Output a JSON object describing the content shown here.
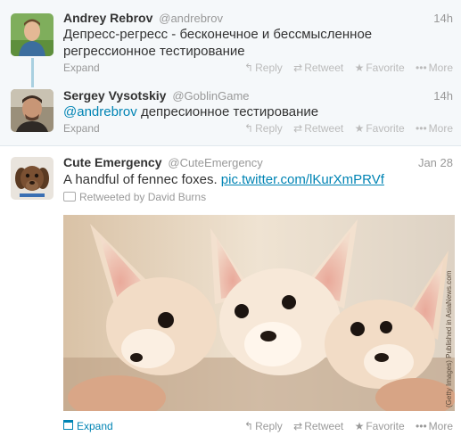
{
  "tweets": [
    {
      "fullname": "Andrey Rebrov",
      "username": "@andrebrov",
      "time": "14h",
      "text": "Депресс-регресс - бесконечное и бессмысленное регрессионное тестирование",
      "expand": "Expand",
      "actions": {
        "reply": "Reply",
        "retweet": "Retweet",
        "favorite": "Favorite",
        "more": "More"
      }
    },
    {
      "fullname": "Sergey Vysotskiy",
      "username": "@GoblinGame",
      "time": "14h",
      "mention": "@andrebrov",
      "text": " депресионное тестирование",
      "expand": "Expand",
      "actions": {
        "reply": "Reply",
        "retweet": "Retweet",
        "favorite": "Favorite",
        "more": "More"
      }
    },
    {
      "fullname": "Cute Emergency",
      "username": "@CuteEmergency",
      "time": "Jan 28",
      "text": "A handful of fennec foxes. ",
      "link": "pic.twitter.com/lKurXmPRVf",
      "retweeted_by": "Retweeted by David Burns",
      "photo_credit": "(Getty Images) Published in AsiaNews.com",
      "expand": "Expand",
      "actions": {
        "reply": "Reply",
        "retweet": "Retweet",
        "favorite": "Favorite",
        "more": "More"
      }
    }
  ],
  "icons": {
    "reply": "↰",
    "retweet": "⇄",
    "favorite": "★",
    "more": "•••"
  },
  "colors": {
    "link": "#0084b4",
    "conversation_bg": "#f5f8fa",
    "thread_line": "#a9d0e0",
    "muted": "#999999"
  }
}
